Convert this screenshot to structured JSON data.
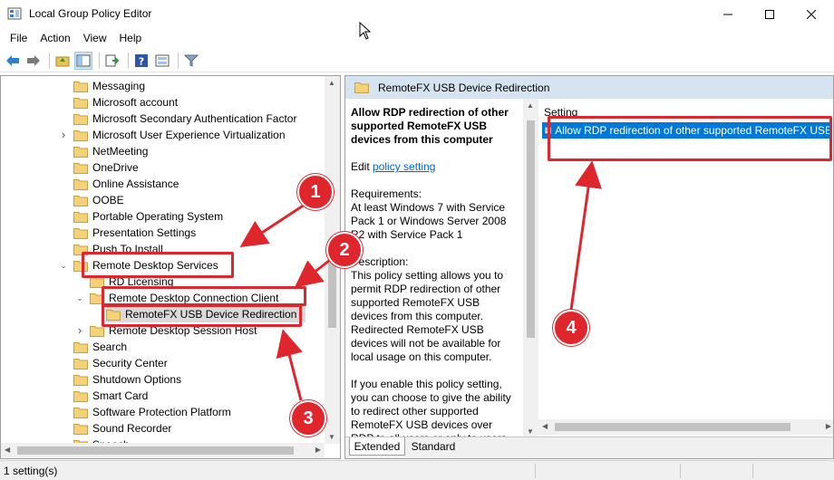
{
  "window": {
    "title": "Local Group Policy Editor"
  },
  "menu": [
    "File",
    "Action",
    "View",
    "Help"
  ],
  "toolbar": {
    "buttons": [
      "back-icon",
      "forward-icon",
      "up-folder-icon",
      "show-hide-tree-icon",
      "export-list-icon",
      "help-icon",
      "properties-icon",
      "filter-icon"
    ]
  },
  "tree": {
    "items": [
      {
        "label": "Messaging",
        "level": 0,
        "expander": "",
        "selected": false
      },
      {
        "label": "Microsoft account",
        "level": 0,
        "expander": "",
        "selected": false
      },
      {
        "label": "Microsoft Secondary Authentication Factor",
        "level": 0,
        "expander": "",
        "selected": false
      },
      {
        "label": "Microsoft User Experience Virtualization",
        "level": 0,
        "expander": ">",
        "selected": false
      },
      {
        "label": "NetMeeting",
        "level": 0,
        "expander": "",
        "selected": false
      },
      {
        "label": "OneDrive",
        "level": 0,
        "expander": "",
        "selected": false
      },
      {
        "label": "Online Assistance",
        "level": 0,
        "expander": "",
        "selected": false
      },
      {
        "label": "OOBE",
        "level": 0,
        "expander": "",
        "selected": false
      },
      {
        "label": "Portable Operating System",
        "level": 0,
        "expander": "",
        "selected": false
      },
      {
        "label": "Presentation Settings",
        "level": 0,
        "expander": "",
        "selected": false
      },
      {
        "label": "Push To Install",
        "level": 0,
        "expander": "",
        "selected": false
      },
      {
        "label": "Remote Desktop Services",
        "level": 0,
        "expander": "v",
        "selected": false
      },
      {
        "label": "RD Licensing",
        "level": 1,
        "expander": "",
        "selected": false
      },
      {
        "label": "Remote Desktop Connection Client",
        "level": 1,
        "expander": "v",
        "selected": false
      },
      {
        "label": "RemoteFX USB Device Redirection",
        "level": 2,
        "expander": "",
        "selected": true
      },
      {
        "label": "Remote Desktop Session Host",
        "level": 1,
        "expander": ">",
        "selected": false
      },
      {
        "label": "Search",
        "level": 0,
        "expander": "",
        "selected": false
      },
      {
        "label": "Security Center",
        "level": 0,
        "expander": "",
        "selected": false
      },
      {
        "label": "Shutdown Options",
        "level": 0,
        "expander": "",
        "selected": false
      },
      {
        "label": "Smart Card",
        "level": 0,
        "expander": "",
        "selected": false
      },
      {
        "label": "Software Protection Platform",
        "level": 0,
        "expander": "",
        "selected": false
      },
      {
        "label": "Sound Recorder",
        "level": 0,
        "expander": "",
        "selected": false
      },
      {
        "label": "Speech",
        "level": 0,
        "expander": "",
        "selected": false
      }
    ]
  },
  "right": {
    "header": "RemoteFX USB Device Redirection",
    "description": {
      "title": "Allow RDP redirection of other supported RemoteFX USB devices from this computer",
      "edit_prefix": "Edit",
      "edit_link": "policy setting",
      "requirements_label": "Requirements:",
      "requirements": "At least Windows 7 with Service Pack 1 or Windows Server 2008 R2 with Service Pack 1",
      "description_label": "Description:",
      "description": "This policy setting allows you to permit RDP redirection of other supported RemoteFX USB devices from this computer. Redirected RemoteFX USB devices will not be available for local usage on this computer.",
      "enable_text": "If you enable this policy setting, you can choose to give the ability to redirect other supported RemoteFX USB devices over RDP to all users or only to users who"
    },
    "column_header": "Setting",
    "settings": [
      "Allow RDP redirection of other supported RemoteFX USB"
    ],
    "tabs": [
      "Extended",
      "Standard"
    ]
  },
  "status": {
    "text": "1 setting(s)"
  },
  "annotations": {
    "markers": [
      "1",
      "2",
      "3",
      "4"
    ],
    "color": "#e0262d"
  }
}
